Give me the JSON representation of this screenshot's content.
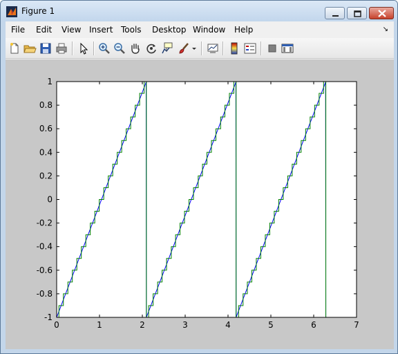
{
  "window": {
    "title": "Figure 1"
  },
  "menu": [
    "File",
    "Edit",
    "View",
    "Insert",
    "Tools",
    "Desktop",
    "Window",
    "Help"
  ],
  "toolbar": {
    "buttons": [
      "new-figure-icon",
      "open-file-icon",
      "save-icon",
      "print-icon",
      "select-arrow-icon",
      "zoom-in-icon",
      "zoom-out-icon",
      "pan-hand-icon",
      "rotate-3d-icon",
      "data-cursor-icon",
      "brush-icon",
      "brush-dropdown-icon",
      "link-plot-icon",
      "colorbar-icon",
      "legend-icon",
      "hide-plot-tools-icon",
      "show-plot-tools-icon"
    ]
  },
  "colors": {
    "series_blue": "#0000ff",
    "series_green": "#008000",
    "figure_bg": "#c8c8c8"
  },
  "chart_data": {
    "type": "line",
    "title": "",
    "xlabel": "",
    "ylabel": "",
    "xlim": [
      0,
      7
    ],
    "ylim": [
      -1,
      1
    ],
    "xticks": [
      "0",
      "1",
      "2",
      "3",
      "4",
      "5",
      "6",
      "7"
    ],
    "yticks": [
      "-1",
      "-0.8",
      "-0.6",
      "-0.4",
      "-0.2",
      "0",
      "0.2",
      "0.4",
      "0.6",
      "0.8",
      "1"
    ],
    "grid": false,
    "legend": "none",
    "series": [
      {
        "color": "#0000ff",
        "style": "sawtooth",
        "period": 2.0944,
        "x_end": 6.2832
      },
      {
        "color": "#008000",
        "style": "quantized sawtooth",
        "step": 0.1,
        "period": 2.0944,
        "x_end": 6.2832
      }
    ]
  }
}
